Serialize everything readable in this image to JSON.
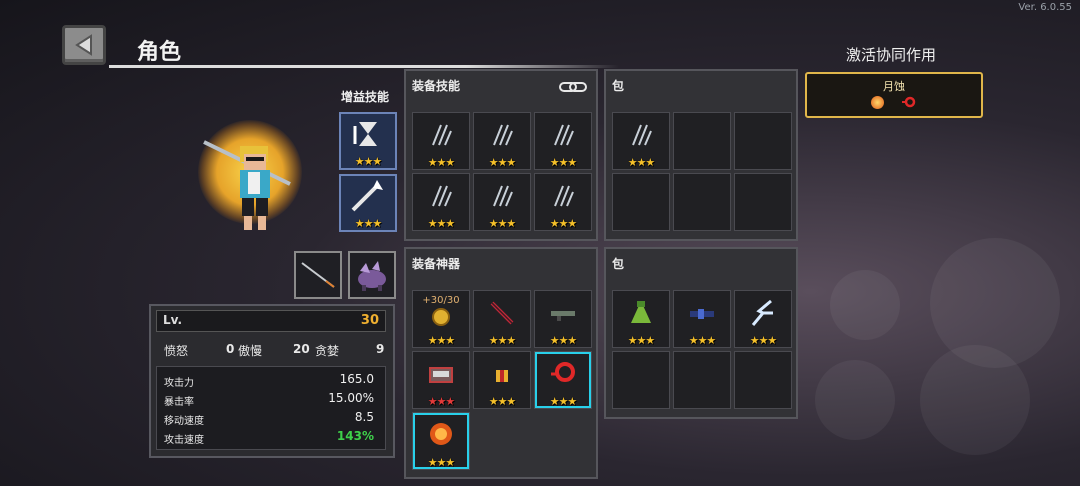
{
  "version": "Ver. 6.0.55",
  "header": {
    "title": "角色"
  },
  "synergy": {
    "title": "激活协同作用",
    "name": "月蚀"
  },
  "buff_section": {
    "title": "增益技能"
  },
  "skills_panel": {
    "title": "装备技能"
  },
  "skills_bag_panel": {
    "title": "包"
  },
  "artifacts_panel": {
    "title": "装备神器"
  },
  "artifacts_bag_panel": {
    "title": "包"
  },
  "stars": {
    "three": "★★★"
  },
  "artifact_badge": "+30/30",
  "stats": {
    "level_label": "Lv.",
    "level_value": "30",
    "traits": [
      {
        "label": "愤怒",
        "value": "0"
      },
      {
        "label": "傲慢",
        "value": "20"
      },
      {
        "label": "贪婪",
        "value": "9"
      }
    ],
    "details": [
      {
        "label": "攻击力",
        "value": "165.0"
      },
      {
        "label": "暴击率",
        "value": "15.00%"
      },
      {
        "label": "移动速度",
        "value": "8.5"
      },
      {
        "label": "攻击速度",
        "value": "143%"
      }
    ]
  },
  "colors": {
    "accent_gold": "#e0b64a",
    "level": "#f0b030",
    "attack_speed": "#3ed04a",
    "selected_outline": "#29d0ea"
  }
}
